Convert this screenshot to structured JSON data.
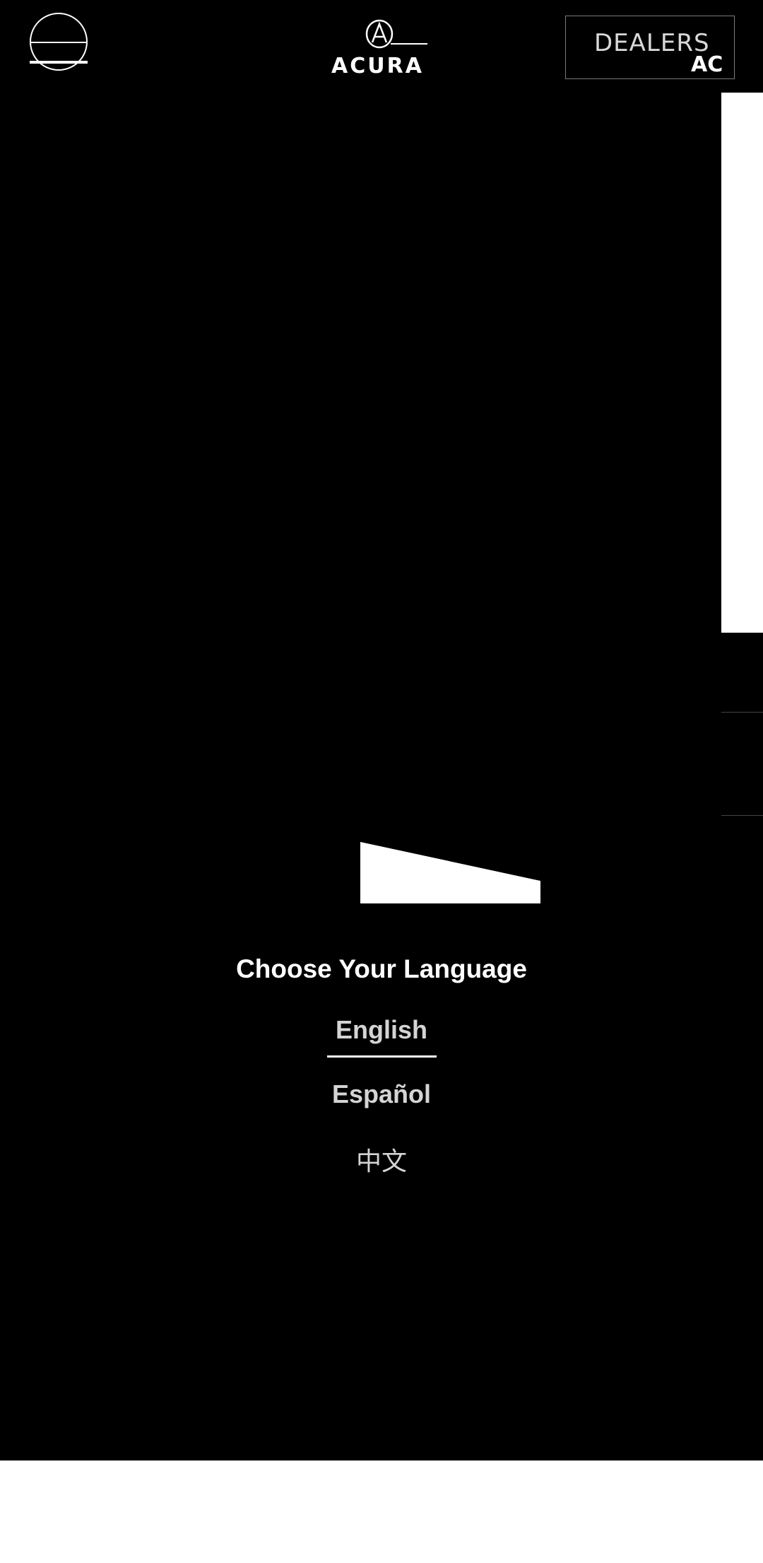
{
  "header": {
    "menu_icon": "hamburger-menu-icon",
    "brand_name": "ACURA",
    "dealers_label": "DEALERS",
    "dealers_sub": "AC"
  },
  "language_chooser": {
    "title": "Choose Your Language",
    "options": [
      {
        "label": "English",
        "selected": true
      },
      {
        "label": "Español",
        "selected": false
      },
      {
        "label": "中文",
        "selected": false
      }
    ]
  },
  "colors": {
    "background": "#000000",
    "text": "#ffffff",
    "option_text": "#d4d4d4",
    "footer": "#ffffff"
  }
}
